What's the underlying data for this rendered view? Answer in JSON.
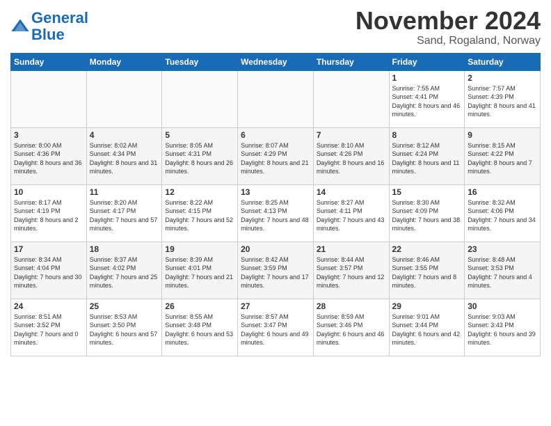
{
  "header": {
    "logo_line1": "General",
    "logo_line2": "Blue",
    "month": "November 2024",
    "location": "Sand, Rogaland, Norway"
  },
  "weekdays": [
    "Sunday",
    "Monday",
    "Tuesday",
    "Wednesday",
    "Thursday",
    "Friday",
    "Saturday"
  ],
  "weeks": [
    [
      {
        "day": "",
        "info": ""
      },
      {
        "day": "",
        "info": ""
      },
      {
        "day": "",
        "info": ""
      },
      {
        "day": "",
        "info": ""
      },
      {
        "day": "",
        "info": ""
      },
      {
        "day": "1",
        "info": "Sunrise: 7:55 AM\nSunset: 4:41 PM\nDaylight: 8 hours and 46 minutes."
      },
      {
        "day": "2",
        "info": "Sunrise: 7:57 AM\nSunset: 4:39 PM\nDaylight: 8 hours and 41 minutes."
      }
    ],
    [
      {
        "day": "3",
        "info": "Sunrise: 8:00 AM\nSunset: 4:36 PM\nDaylight: 8 hours and 36 minutes."
      },
      {
        "day": "4",
        "info": "Sunrise: 8:02 AM\nSunset: 4:34 PM\nDaylight: 8 hours and 31 minutes."
      },
      {
        "day": "5",
        "info": "Sunrise: 8:05 AM\nSunset: 4:31 PM\nDaylight: 8 hours and 26 minutes."
      },
      {
        "day": "6",
        "info": "Sunrise: 8:07 AM\nSunset: 4:29 PM\nDaylight: 8 hours and 21 minutes."
      },
      {
        "day": "7",
        "info": "Sunrise: 8:10 AM\nSunset: 4:26 PM\nDaylight: 8 hours and 16 minutes."
      },
      {
        "day": "8",
        "info": "Sunrise: 8:12 AM\nSunset: 4:24 PM\nDaylight: 8 hours and 11 minutes."
      },
      {
        "day": "9",
        "info": "Sunrise: 8:15 AM\nSunset: 4:22 PM\nDaylight: 8 hours and 7 minutes."
      }
    ],
    [
      {
        "day": "10",
        "info": "Sunrise: 8:17 AM\nSunset: 4:19 PM\nDaylight: 8 hours and 2 minutes."
      },
      {
        "day": "11",
        "info": "Sunrise: 8:20 AM\nSunset: 4:17 PM\nDaylight: 7 hours and 57 minutes."
      },
      {
        "day": "12",
        "info": "Sunrise: 8:22 AM\nSunset: 4:15 PM\nDaylight: 7 hours and 52 minutes."
      },
      {
        "day": "13",
        "info": "Sunrise: 8:25 AM\nSunset: 4:13 PM\nDaylight: 7 hours and 48 minutes."
      },
      {
        "day": "14",
        "info": "Sunrise: 8:27 AM\nSunset: 4:11 PM\nDaylight: 7 hours and 43 minutes."
      },
      {
        "day": "15",
        "info": "Sunrise: 8:30 AM\nSunset: 4:09 PM\nDaylight: 7 hours and 38 minutes."
      },
      {
        "day": "16",
        "info": "Sunrise: 8:32 AM\nSunset: 4:06 PM\nDaylight: 7 hours and 34 minutes."
      }
    ],
    [
      {
        "day": "17",
        "info": "Sunrise: 8:34 AM\nSunset: 4:04 PM\nDaylight: 7 hours and 30 minutes."
      },
      {
        "day": "18",
        "info": "Sunrise: 8:37 AM\nSunset: 4:02 PM\nDaylight: 7 hours and 25 minutes."
      },
      {
        "day": "19",
        "info": "Sunrise: 8:39 AM\nSunset: 4:01 PM\nDaylight: 7 hours and 21 minutes."
      },
      {
        "day": "20",
        "info": "Sunrise: 8:42 AM\nSunset: 3:59 PM\nDaylight: 7 hours and 17 minutes."
      },
      {
        "day": "21",
        "info": "Sunrise: 8:44 AM\nSunset: 3:57 PM\nDaylight: 7 hours and 12 minutes."
      },
      {
        "day": "22",
        "info": "Sunrise: 8:46 AM\nSunset: 3:55 PM\nDaylight: 7 hours and 8 minutes."
      },
      {
        "day": "23",
        "info": "Sunrise: 8:48 AM\nSunset: 3:53 PM\nDaylight: 7 hours and 4 minutes."
      }
    ],
    [
      {
        "day": "24",
        "info": "Sunrise: 8:51 AM\nSunset: 3:52 PM\nDaylight: 7 hours and 0 minutes."
      },
      {
        "day": "25",
        "info": "Sunrise: 8:53 AM\nSunset: 3:50 PM\nDaylight: 6 hours and 57 minutes."
      },
      {
        "day": "26",
        "info": "Sunrise: 8:55 AM\nSunset: 3:48 PM\nDaylight: 6 hours and 53 minutes."
      },
      {
        "day": "27",
        "info": "Sunrise: 8:57 AM\nSunset: 3:47 PM\nDaylight: 6 hours and 49 minutes."
      },
      {
        "day": "28",
        "info": "Sunrise: 8:59 AM\nSunset: 3:46 PM\nDaylight: 6 hours and 46 minutes."
      },
      {
        "day": "29",
        "info": "Sunrise: 9:01 AM\nSunset: 3:44 PM\nDaylight: 6 hours and 42 minutes."
      },
      {
        "day": "30",
        "info": "Sunrise: 9:03 AM\nSunset: 3:43 PM\nDaylight: 6 hours and 39 minutes."
      }
    ]
  ]
}
